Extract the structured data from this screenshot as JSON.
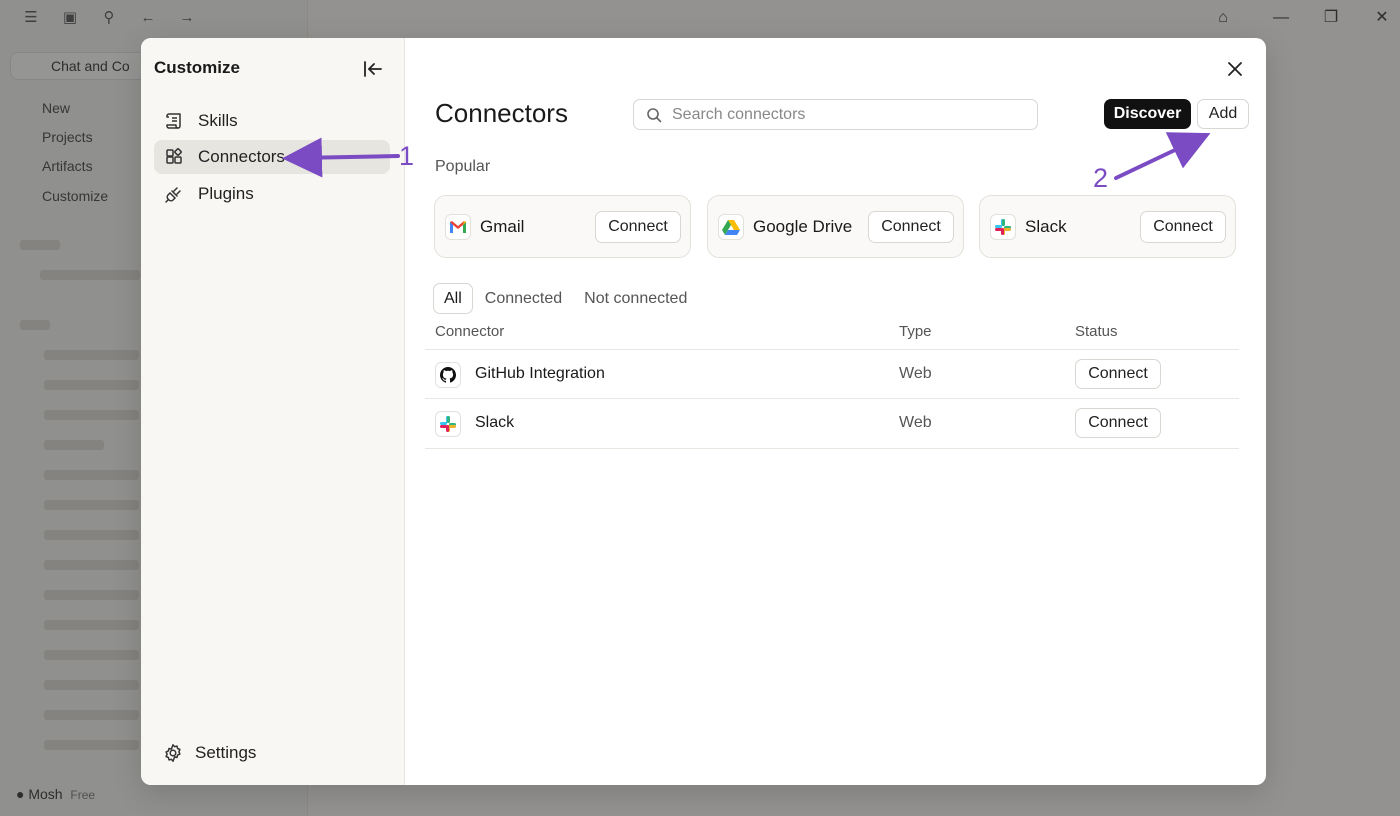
{
  "background": {
    "chip_label": "Chat and Co",
    "nav": [
      "New",
      "Projects",
      "Artifacts",
      "Customize"
    ],
    "user": "Mosh",
    "plan": "Free"
  },
  "modal": {
    "sidebar": {
      "title": "Customize",
      "items": [
        {
          "label": "Skills",
          "icon": "scroll-icon"
        },
        {
          "label": "Connectors",
          "icon": "connectors-grid-icon",
          "active": true
        },
        {
          "label": "Plugins",
          "icon": "plug-icon"
        }
      ],
      "settings_label": "Settings"
    },
    "header": {
      "title": "Connectors",
      "search_placeholder": "Search connectors",
      "discover_label": "Discover",
      "add_label": "Add"
    },
    "popular": {
      "label": "Popular",
      "cards": [
        {
          "name": "Gmail",
          "icon": "gmail-icon",
          "button": "Connect"
        },
        {
          "name": "Google Drive",
          "icon": "google-drive-icon",
          "button": "Connect"
        },
        {
          "name": "Slack",
          "icon": "slack-icon",
          "button": "Connect"
        }
      ]
    },
    "filters": [
      "All",
      "Connected",
      "Not connected"
    ],
    "table": {
      "columns": [
        "Connector",
        "Type",
        "Status"
      ],
      "rows": [
        {
          "name": "GitHub Integration",
          "type": "Web",
          "status": "Connect",
          "icon": "github-icon"
        },
        {
          "name": "Slack",
          "type": "Web",
          "status": "Connect",
          "icon": "slack-icon"
        }
      ]
    }
  },
  "annotations": {
    "marker_1": "1",
    "marker_2": "2",
    "color": "#7b4bc4"
  }
}
